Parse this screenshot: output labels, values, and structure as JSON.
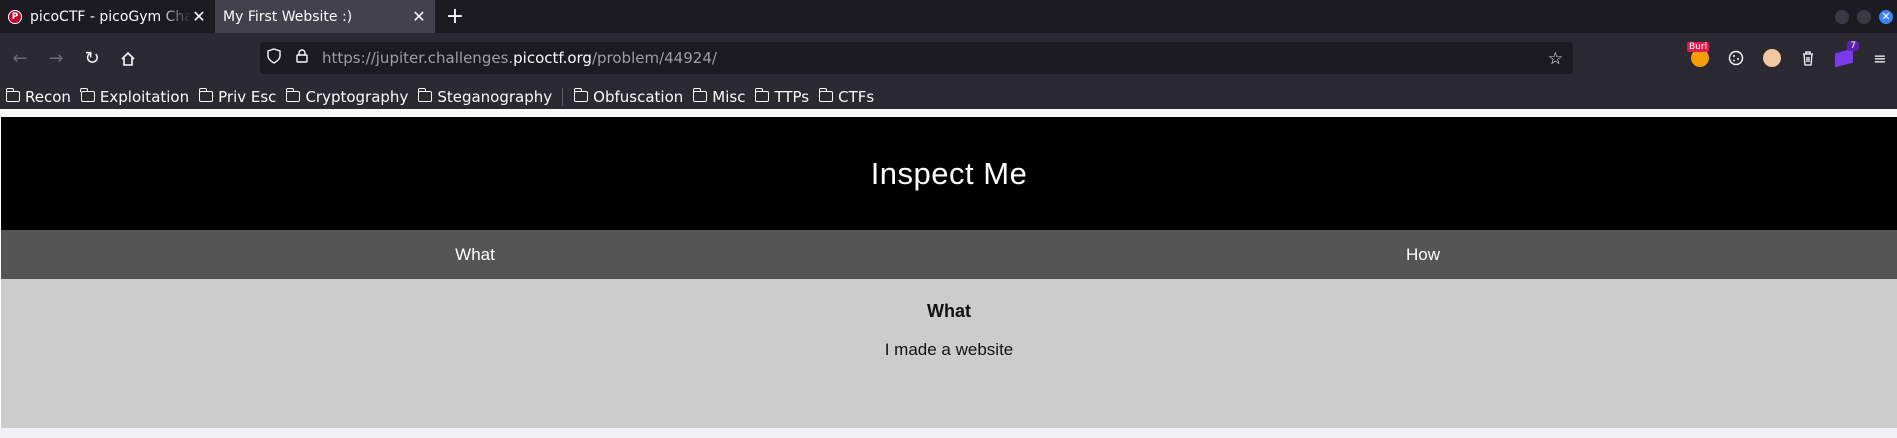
{
  "tabs": [
    {
      "title": "picoCTF - picoGym Challenges",
      "favicon": "picoctf-favicon-icon",
      "active": false
    },
    {
      "title": "My First Website :)",
      "active": true
    }
  ],
  "navbar": {
    "url_prefix": "https://jupiter.challenges.",
    "url_domain": "picoctf.org",
    "url_path": "/problem/44924/"
  },
  "extensions": {
    "burp_badge": "Burl",
    "wappalyzer_badge": "7"
  },
  "bookmarks": [
    {
      "label": "Recon"
    },
    {
      "label": "Exploitation"
    },
    {
      "label": "Priv Esc"
    },
    {
      "label": "Cryptography"
    },
    {
      "label": "Steganography"
    },
    {
      "label": "Obfuscation"
    },
    {
      "label": "Misc"
    },
    {
      "label": "TTPs"
    },
    {
      "label": "CTFs"
    }
  ],
  "site": {
    "title": "Inspect Me",
    "tabs": [
      {
        "label": "What"
      },
      {
        "label": "How"
      }
    ],
    "section_heading": "What",
    "section_text": "I made a website"
  },
  "colors": {
    "header_bg": "#000000",
    "tab_bar_bg": "#555555",
    "content_bg": "#cccccc",
    "browser_chrome": "#2b2a33"
  }
}
